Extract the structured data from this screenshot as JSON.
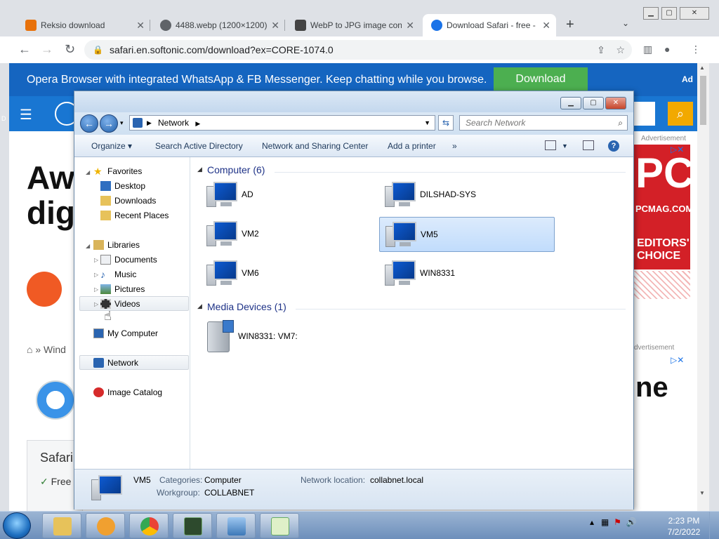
{
  "browser": {
    "tabs": [
      {
        "title": "Reksio download",
        "favicon_color": "#e8710a",
        "active": false
      },
      {
        "title": "4488.webp (1200×1200)",
        "favicon_color": "#5f6368",
        "active": false
      },
      {
        "title": "WebP to JPG image converter",
        "favicon_color": "#444444",
        "active": false
      },
      {
        "title": "Download Safari - free - latest",
        "favicon_color": "#1a73e8",
        "active": true
      }
    ],
    "new_tab_symbol": "+",
    "url": "safari.en.softonic.com/download?ex=CORE-1074.0"
  },
  "page": {
    "ad_text": "Opera Browser with integrated WhatsApp & FB Messenger. Keep chatting while you browse.",
    "ad_button": "Download",
    "ad_label": "Ad",
    "title_line1": "Aw",
    "title_line2": "dig",
    "breadcrumb": "Wind",
    "card_title": "Safari",
    "card_feature": "Free",
    "advertisement_label": "Advertisement",
    "advertisement_label_2": "dvertisement",
    "pcmag_big": "PC",
    "pcmag_site": "PCMAG.COM",
    "pcmag_award": "EDITORS' CHOICE",
    "ad2_text": "ne"
  },
  "explorer": {
    "address_path": "Network",
    "search_placeholder": "Search Network",
    "commands": [
      "Organize ▾",
      "Search Active Directory",
      "Network and Sharing Center",
      "Add a printer",
      "»"
    ],
    "nav": {
      "favorites": "Favorites",
      "desktop": "Desktop",
      "downloads": "Downloads",
      "recent": "Recent Places",
      "libraries": "Libraries",
      "documents": "Documents",
      "music": "Music",
      "pictures": "Pictures",
      "videos": "Videos",
      "mycomputer": "My Computer",
      "network": "Network",
      "imagecatalog": "Image Catalog"
    },
    "group_computer": "Computer (6)",
    "group_media": "Media Devices (1)",
    "computers": [
      "AD",
      "DILSHAD-SYS",
      "VM2",
      "VM5",
      "VM6",
      "WIN8331"
    ],
    "selected_computer": "VM5",
    "media_device": "WIN8331: VM7:",
    "details": {
      "name": "VM5",
      "categories_label": "Categories:",
      "categories_value": "Computer",
      "workgroup_label": "Workgroup:",
      "workgroup_value": "COLLABNET",
      "location_label": "Network location:",
      "location_value": "collabnet.local"
    }
  },
  "taskbar": {
    "time": "2:23 PM",
    "date": "7/2/2022"
  },
  "colors": {
    "ad_bar": "#1565c0",
    "site_header": "#1976d2",
    "download_button": "#4caf50",
    "selection": "#c1dcfc"
  }
}
